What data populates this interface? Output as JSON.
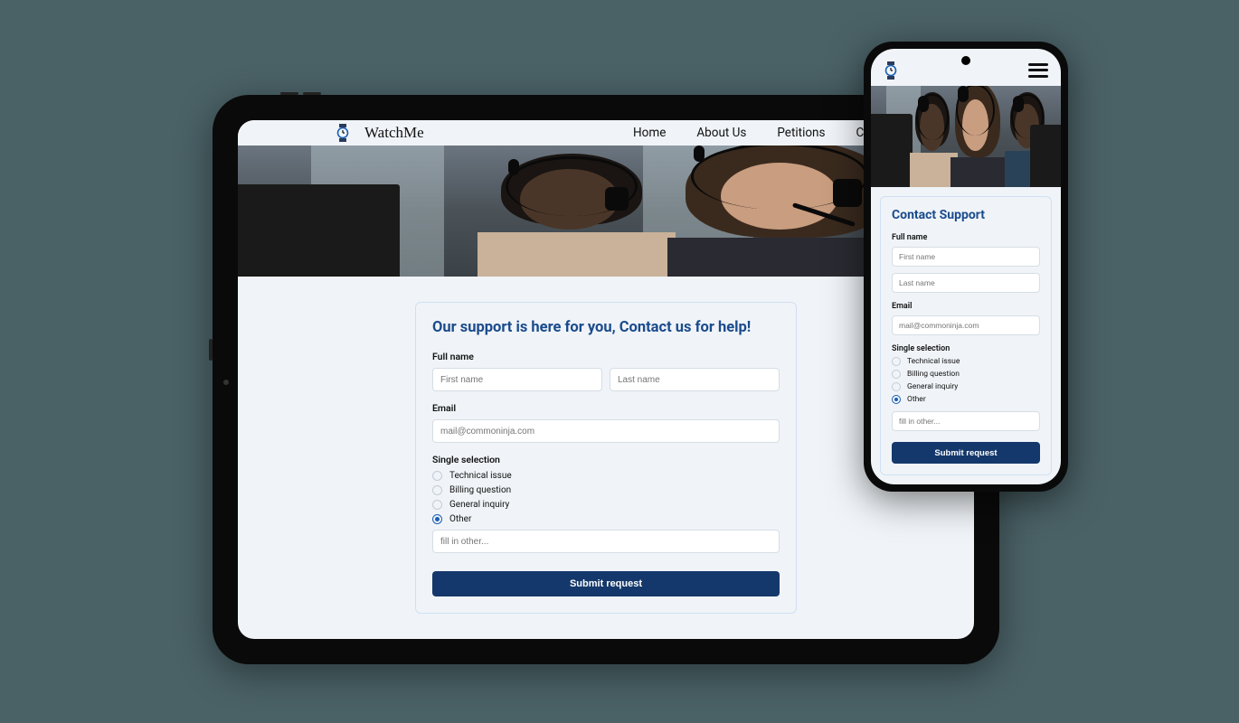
{
  "brand": "WatchMe",
  "nav": {
    "home": "Home",
    "about": "About Us",
    "petitions": "Petitions",
    "contact": "Co"
  },
  "tablet": {
    "title": "Our support is here for you, Contact us for help!",
    "full_name_label": "Full name",
    "first_name_placeholder": "First name",
    "last_name_placeholder": "Last name",
    "email_label": "Email",
    "email_placeholder": "mail@commoninja.com",
    "single_selection_label": "Single selection",
    "options": {
      "technical": "Technical issue",
      "billing": "Billing question",
      "general": "General inquiry",
      "other": "Other"
    },
    "other_placeholder": "fill in other...",
    "submit": "Submit request"
  },
  "phone": {
    "title": "Contact Support",
    "full_name_label": "Full name",
    "first_name_placeholder": "First name",
    "last_name_placeholder": "Last name",
    "email_label": "Email",
    "email_placeholder": "mail@commoninja.com",
    "single_selection_label": "Single selection",
    "options": {
      "technical": "Technical issue",
      "billing": "Billing question",
      "general": "General inquiry",
      "other": "Other"
    },
    "other_placeholder": "fill in other...",
    "submit": "Submit request"
  },
  "colors": {
    "primary": "#14386b",
    "accent": "#1a4b8c",
    "radio": "#1a5fb4"
  }
}
